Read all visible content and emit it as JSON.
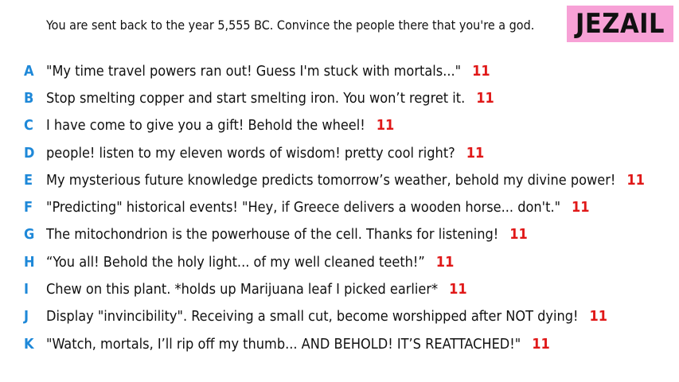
{
  "prompt": "You are sent back to the year 5,555 BC. Convince the people there that you're a god.",
  "player_name": "JEZAIL",
  "colors": {
    "letter": "#1e88d8",
    "score": "#e01818",
    "badge_bg": "#f7a1d6",
    "text": "#111111"
  },
  "answers": [
    {
      "letter": "A",
      "text": "\"My time travel powers ran out! Guess I'm stuck with mortals...\"",
      "score": "11"
    },
    {
      "letter": "B",
      "text": "Stop smelting copper and start smelting iron. You won’t regret it.",
      "score": "11"
    },
    {
      "letter": "C",
      "text": "I have come to give you a gift! Behold the wheel!",
      "score": "11"
    },
    {
      "letter": "D",
      "text": "people! listen to my eleven words of wisdom! pretty cool right?",
      "score": "11"
    },
    {
      "letter": "E",
      "text": "My mysterious future knowledge predicts tomorrow’s weather, behold my divine power!",
      "score": "11"
    },
    {
      "letter": "F",
      "text": "\"Predicting\" historical events! \"Hey, if Greece delivers a wooden horse... don't.\"",
      "score": "11"
    },
    {
      "letter": "G",
      "text": "The mitochondrion is the powerhouse of the cell. Thanks for listening!",
      "score": "11"
    },
    {
      "letter": "H",
      "text": "“You all! Behold the holy light... of my well cleaned teeth!”",
      "score": "11"
    },
    {
      "letter": "I",
      "text": "Chew on this plant. *holds up Marijuana leaf I picked earlier*",
      "score": "11"
    },
    {
      "letter": "J",
      "text": "Display \"invincibility\". Receiving a small cut, become worshipped after NOT dying!",
      "score": "11"
    },
    {
      "letter": "K",
      "text": "\"Watch, mortals, I’ll rip off my thumb... AND BEHOLD! IT’S REATTACHED!\"",
      "score": "11"
    }
  ]
}
